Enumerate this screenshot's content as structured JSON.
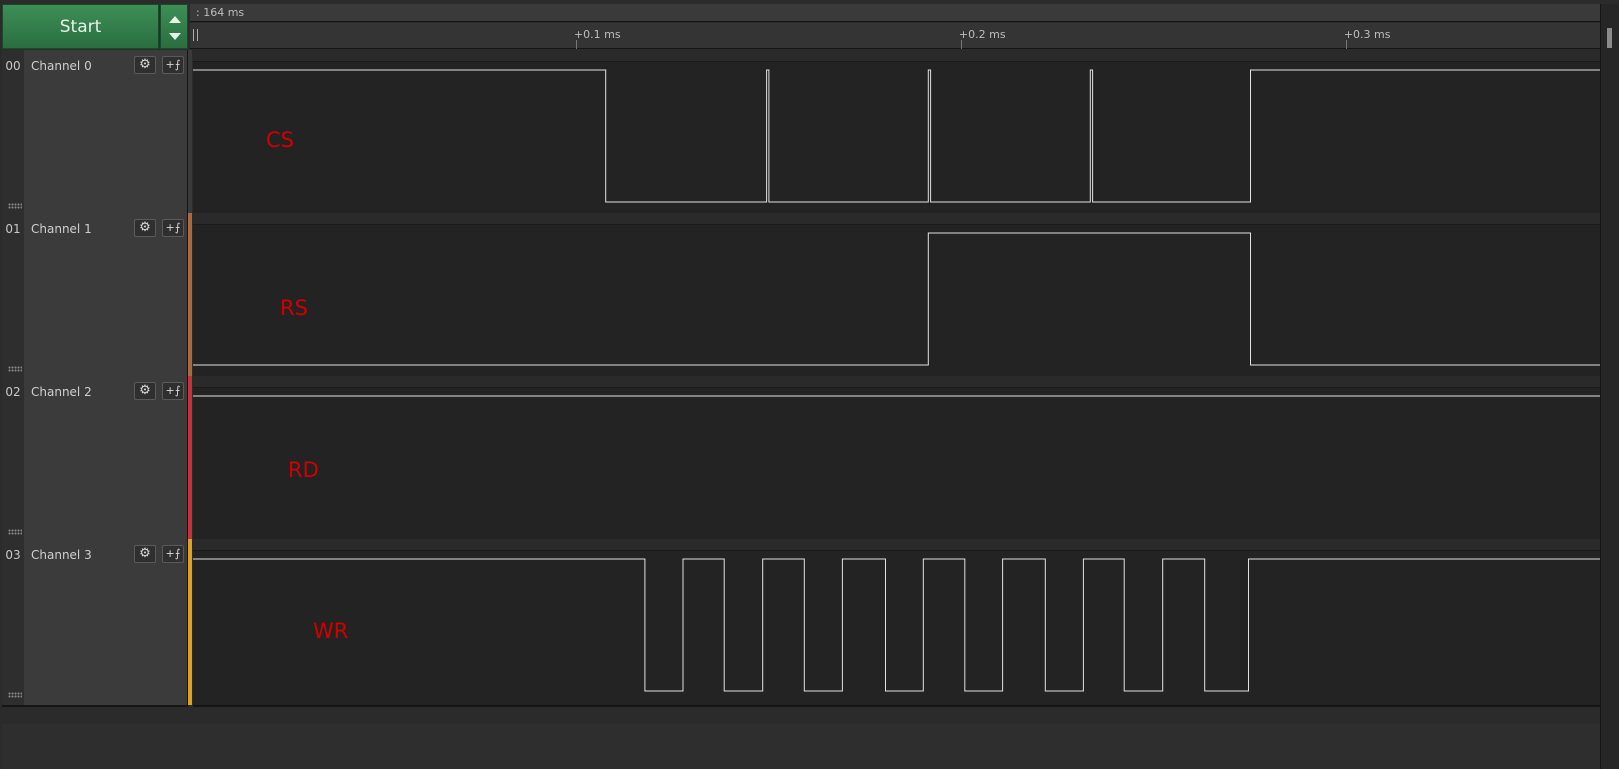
{
  "toolbar": {
    "start_label": "Start",
    "speed_icons": [
      "triangle-up-icon",
      "triangle-down-icon"
    ]
  },
  "timeline": {
    "top_text": ": 164 ms",
    "ticks": [
      {
        "label": "+0.1 ms",
        "t": 0.1
      },
      {
        "label": "+0.2 ms",
        "t": 0.2
      },
      {
        "label": "+0.3 ms",
        "t": 0.3
      }
    ],
    "view_end_ms": 0.3655
  },
  "colors": {
    "trace": "#e2e2e2",
    "signal_label": "#d00000",
    "channel_colors": [
      "#3a3a3a",
      "#a86a3e",
      "#c8303a",
      "#e0a020"
    ]
  },
  "channels": [
    {
      "number": "00",
      "name": "Channel 0",
      "signal": "CS",
      "initial_level": 1,
      "edges_ms": [
        0.1072,
        0.149,
        0.1496,
        0.191,
        0.1916,
        0.2331,
        0.2337,
        0.2747
      ]
    },
    {
      "number": "01",
      "name": "Channel 1",
      "signal": "RS",
      "initial_level": 0,
      "edges_ms": [
        0.191,
        0.2747
      ]
    },
    {
      "number": "02",
      "name": "Channel 2",
      "signal": "RD",
      "initial_level": 1,
      "edges_ms": []
    },
    {
      "number": "03",
      "name": "Channel 3",
      "signal": "WR",
      "initial_level": 1,
      "edges_ms": [
        0.1174,
        0.1273,
        0.138,
        0.148,
        0.1588,
        0.1687,
        0.1799,
        0.1897,
        0.2005,
        0.2103,
        0.2214,
        0.2313,
        0.2419,
        0.2519,
        0.2628,
        0.2742
      ]
    }
  ]
}
